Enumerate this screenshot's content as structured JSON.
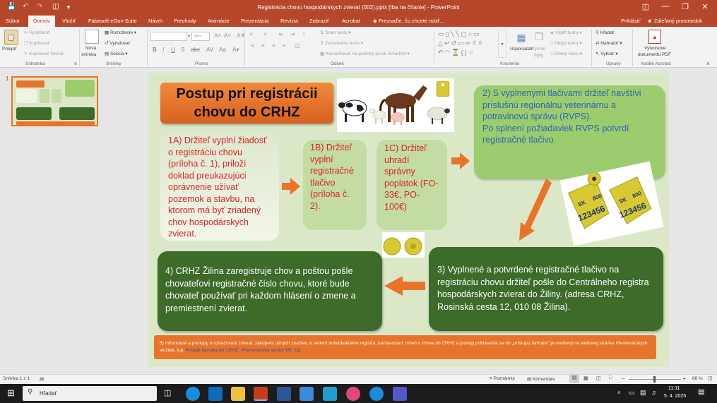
{
  "titlebar": {
    "title": "Registrácia chovu hospodárskych zvierat (002).pptx [Iba na čítanie] - PowerPoint",
    "user": "Prihlásiť",
    "shared_space": "Zdieľaný prostriedok"
  },
  "tabs": [
    "Súbor",
    "Domov",
    "Vložiť",
    "Fabasoft eGov-Suite",
    "Návrh",
    "Prechody",
    "Animácie",
    "Prezentácia",
    "Revízia",
    "Zobraziť",
    "Acrobat"
  ],
  "active_tab": "Domov",
  "tell_me": "Prezraďte, čo chcete robiť...",
  "ribbon": {
    "paste": "Prilepiť",
    "cut": "Vystrihnúť",
    "copy": "Kopírovať",
    "format_painter": "Kopírovať formát",
    "new_slide_1": "Nová",
    "new_slide_2": "snímka",
    "layout": "Rozloženie",
    "reset": "Vynulovať",
    "section": "Sekcia",
    "font_name": "",
    "font_size": "18+",
    "text_direction": "Smer textu",
    "align_text": "Zarovnanie textu",
    "convert_smartart": "Konvertovať na grafický prvok SmartArt",
    "arrange": "Usporiadať",
    "quick_styles_1": "Rýchle",
    "quick_styles_2": "štýly",
    "shape_fill": "Výplň tvaru",
    "shape_outline": "Obrys tvaru",
    "shape_effects": "Efekty tvaru",
    "find": "Hľadať",
    "replace": "Nahradiť",
    "select": "Vybrať",
    "create_pdf_1": "Vytvorenie",
    "create_pdf_2": "dokumentu PDF",
    "groups": {
      "clipboard": "Schránka",
      "slides": "Snímky",
      "font": "Písmo",
      "paragraph": "Odsek",
      "drawing": "Kreslenie",
      "editing": "Úpravy",
      "acrobat": "Adobe Acrobat"
    }
  },
  "thumbnail_number": "1",
  "slide": {
    "title_l1": "Postup pri registrácii",
    "title_l2": "chovu do CRHZ",
    "step_1a": "1A) Držiteľ vyplní žiadosť o registráciu chovu (príloha č. 1), priloží doklad preukazujúci oprávnenie užívať pozemok a stavbu, na ktorom má byť zriadený chov hospodárskych zvierat.",
    "step_1b": "1B) Držiteľ vyplní registračné tlačivo (príloha č. 2).",
    "step_1c": "1C) Držiteľ uhradí správny poplatok (FO- 33€, PO-100€)",
    "step_2a": "2) S vyplnenými tlačivami držiteľ navštívi príslušnú regionálnu veterinárnu a potravinovú správu (RVPS).",
    "step_2b": "Po splnení požiadaviek RVPS potvrdí registračné tlačivo.",
    "step_3": "3) Vyplnené a potvrdené registračné tlačivo na registráciu chovu držiteľ pošle do Centrálneho registra hospodárskych zvierat do Žiliny. (adresa CRHZ, Rosinská cesta 12, 010 08 Žilina).",
    "step_4": "4) CRHZ Žilina zaregistruje chov a poštou pošle chovateľovi registračné číslo chovu, ktoré bude chovateľ používať pri každom hlásení o zmene a premiestnení zvierat.",
    "footer_text": "5) Informácie a postupy o označovaní zvierat, zakúpení ušných značiek, o vedení individuálneho registra, nahlasovaní zmien v chove do CRHZ a postup prihlásenia sa do „prístupu farmára\" je uvedený na webovej stránke Plemenárskych služieb, š.p.",
    "footer_link": "Prístup farmára do CEHZ - Plemenárske služby SR, š.p.",
    "tag_text_1": "SK",
    "tag_text_2": "800",
    "tag_text_3": "123456",
    "tag_text_4": "SK",
    "tag_text_5": "800",
    "tag_text_6": "123456"
  },
  "statusbar": {
    "slide_count": "Snímka 1 z 1",
    "notes": "Poznámky",
    "comments": "Komentáre",
    "zoom": "88 %"
  },
  "taskbar": {
    "search": "Hľadať",
    "time": "11:11",
    "date": "5. 4. 2025"
  },
  "colors": {
    "accent": "#b7472a",
    "slide_bg": "#dbe8c8",
    "orange": "#e8742a",
    "dark_green": "#3d6b2a",
    "light_green": "#9ccc6e",
    "step_bubble": "#d3e7bd"
  }
}
